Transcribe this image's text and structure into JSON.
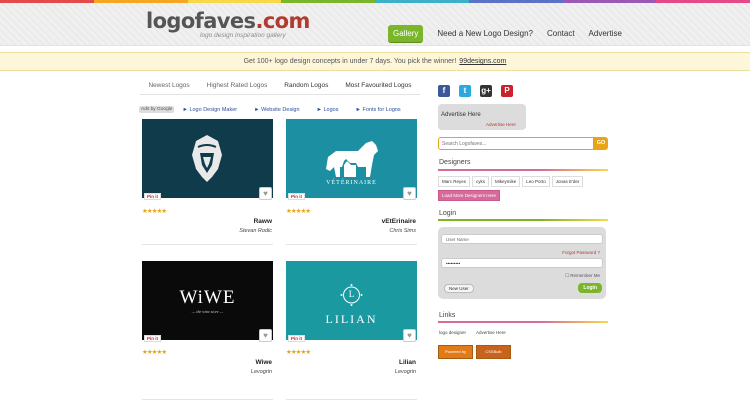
{
  "stripe_colors": [
    "#e34a4a",
    "#f5a623",
    "#f8d84a",
    "#7ab52a",
    "#3bb0c9",
    "#5a73c8",
    "#9b59b6",
    "#e34a86"
  ],
  "header": {
    "logo_part1": "logofaves",
    "logo_part2": ".com",
    "tagline": "logo design inspiration gallery",
    "nav": [
      "Gallery",
      "Need a New Logo Design?",
      "Contact",
      "Advertise"
    ]
  },
  "promo": {
    "text": "Get 100+ logo design concepts in under 7 days. You pick the winner!",
    "link": "99designs.com"
  },
  "tabs": [
    "Newest Logos",
    "Highest Rated Logos",
    "Random Logos",
    "Most Favourited Logos"
  ],
  "ad_row": {
    "tag": "Ads by Google",
    "links": [
      "► Logo Design Maker",
      "► Website Design",
      "► Logos",
      "► Fonts for Logos"
    ]
  },
  "cards": [
    {
      "title": "Raww",
      "author": "Stevan Rodic",
      "bg": "#0f3b4a",
      "logo_text": "",
      "pin": "Pin it",
      "rating": "★★★★★"
    },
    {
      "title": "vEtErinaire",
      "author": "Chris Sims",
      "bg": "#1c8fa2",
      "logo_text": "VÉTÉRINAIRE",
      "pin": "Pin it",
      "rating": "★★★★★"
    },
    {
      "title": "Wiwe",
      "author": "Levogrin",
      "bg": "#0a0a0a",
      "logo_text": "WiWE",
      "logo_sub": "— the wine store —",
      "pin": "Pin it",
      "rating": "★★★★★"
    },
    {
      "title": "Lilian",
      "author": "Levogrin",
      "bg": "#1a9aa0",
      "logo_text": "LILIAN",
      "logo_mark": "L",
      "pin": "Pin it",
      "rating": "★★★★★"
    }
  ],
  "sidebar": {
    "social_icons": [
      "facebook-icon",
      "twitter-icon",
      "google-plus-icon",
      "pinterest-icon"
    ],
    "social_glyphs": [
      "f",
      "t",
      "g+",
      "P"
    ],
    "social_colors": [
      "#3b5998",
      "#2aa9e0",
      "#333333",
      "#c8232c"
    ],
    "advertise_title": "Advertise Here",
    "advertise_sub": "Advertise Here",
    "search_placeholder": "Search Logofaves...",
    "search_button": "GO",
    "designers_heading": "Designers",
    "designers": [
      "Marc Reyes",
      "cyks",
      "Mikeymike",
      "Leo Porto",
      "Jonas E'der"
    ],
    "designers_more": "Load More Designers Here",
    "login_heading": "Login",
    "login_username_placeholder": "User Name",
    "login_forgot": "Forgot Password ?",
    "login_password_value": "•••••••••",
    "login_remember": "Remember Me",
    "login_new_user": "New User",
    "login_button": "Login",
    "links_heading": "Links",
    "links": [
      "logo designer",
      "Advertise Here"
    ],
    "badges": [
      "Powered by HostGator.com",
      "CSSBulb"
    ]
  }
}
